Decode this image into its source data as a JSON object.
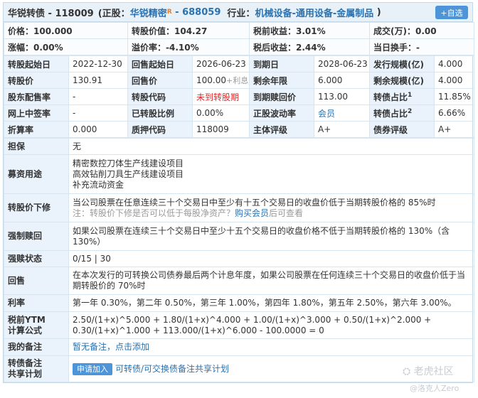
{
  "title": {
    "name_code": "华锐转债 - 118009",
    "paren_open": "(正股：",
    "stock_name": "华锐精密",
    "stock_badge": "R",
    "dash": " - ",
    "stock_code": "688059",
    "industry_label": "  行业：",
    "industry": "机械设备-通用设备-金属制品",
    "paren_close": " )"
  },
  "add_button": "+自选",
  "summary": [
    [
      "价格：100.000",
      "转股价值：104.27",
      "税前收益：3.01%",
      "成交(万)：0.00"
    ],
    [
      "涨幅：0.00%",
      "溢价率：-4.10%",
      "税后收益：2.44%",
      "当日换手：-"
    ]
  ],
  "grid": {
    "r1": [
      "转股起始日",
      "2022-12-30",
      "回售起始日",
      "2026-06-23",
      "到期日",
      "2028-06-23",
      "发行规模(亿)",
      "4.000"
    ],
    "r2": [
      "转股价",
      "130.91",
      "回售价",
      "100.00",
      "+利息",
      "剩余年限",
      "6.000",
      "剩余规模(亿)",
      "4.000"
    ],
    "r3": [
      "股东配售率",
      "-",
      "转股代码",
      "未到转股期",
      "到期赎回价",
      "113.00",
      "转债占比",
      "1",
      "11.85%"
    ],
    "r4": [
      "网上中签率",
      "-",
      "已转股比例",
      "0.00%",
      "正股波动率",
      "会员",
      "转债占比",
      "2",
      "6.66%"
    ],
    "r5": [
      "折算率",
      "0.000",
      "质押代码",
      "118009",
      "主体评级",
      "A+",
      "债券评级",
      "A+"
    ]
  },
  "details": {
    "guarantee": {
      "label": "担保",
      "value": "无"
    },
    "use_of_funds": {
      "label": "募资用途",
      "lines": [
        "精密数控刀体生产线建设项目",
        "高效钻削刀具生产线建设项目",
        "补充流动资金"
      ]
    },
    "reset": {
      "label": "转股价下修",
      "text": "当公司股票在任意连续三十个交易日中至少有十五个交易日的收盘价低于当期转股价格的 85%时",
      "note_prefix": "注：转股价下修是否可以低于每股净资产？",
      "note_link": "购买会员",
      "note_suffix": "后可查看"
    },
    "redeem": {
      "label": "强制赎回",
      "text": "如果公司股票在连续三十个交易日中至少十五个交易日的收盘价格不低于当期转股价格的 130%（含 130%）"
    },
    "redeem_status": {
      "label": "强赎状态",
      "value": "0/15 | 30"
    },
    "putback": {
      "label": "回售",
      "text": "在本次发行的可转换公司债券最后两个计息年度，如果公司股票在任何连续三十个交易日的收盘价低于当期转股价的 70%时"
    },
    "rate": {
      "label": "利率",
      "value": "第一年 0.30%，第二年 0.50%，第三年 1.00%，第四年 1.80%，第五年 2.50%，第六年 3.00%。"
    },
    "ytm": {
      "label_line1": "税前YTM",
      "label_line2": "计算公式",
      "line1": "2.50/(1+x)^5.000 + 1.80/(1+x)^4.000 + 1.00/(1+x)^3.000 + 0.50/(1+x)^2.000 +",
      "line2": "0.30/(1+x)^1.000 + 113.000/(1+x)^6.000 - 100.0000 = 0"
    },
    "notes": {
      "label": "我的备注",
      "value": "暂无备注，点击添加"
    },
    "share": {
      "label_line1": "转债备注",
      "label_line2": "共享计划",
      "apply": "申请加入",
      "text": "可转债/可交换债备注共享计划"
    }
  },
  "watermark": {
    "line1": "老虎社区",
    "line2": "@洛克人Zero"
  }
}
